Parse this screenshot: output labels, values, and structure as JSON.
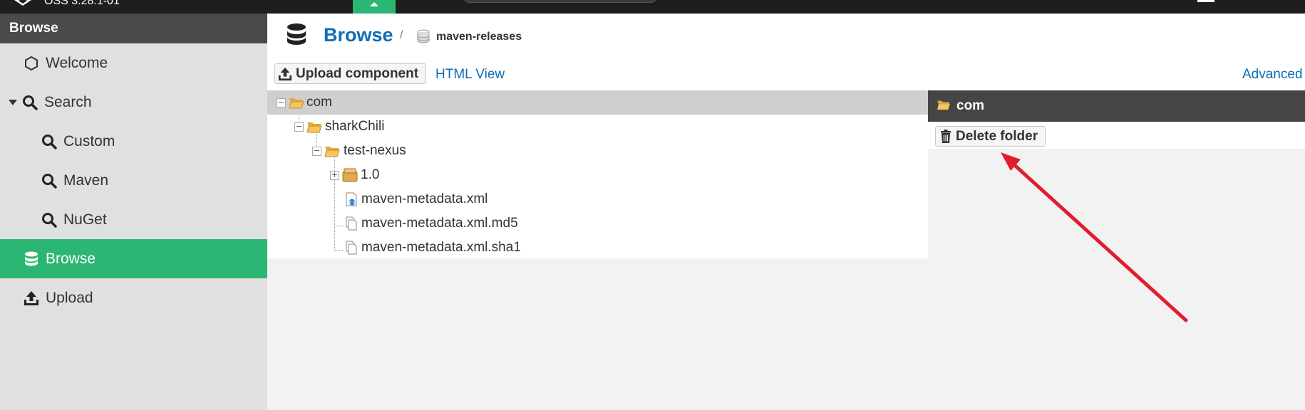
{
  "topbar": {
    "version": "OSS 3.28.1-01"
  },
  "sidebar": {
    "header": "Browse",
    "items": [
      {
        "label": "Welcome",
        "icon": "hexagon-icon"
      },
      {
        "label": "Search",
        "icon": "search-icon"
      },
      {
        "label": "Custom",
        "icon": "search-icon"
      },
      {
        "label": "Maven",
        "icon": "search-icon"
      },
      {
        "label": "NuGet",
        "icon": "search-icon"
      },
      {
        "label": "Browse",
        "icon": "database-icon",
        "active": true
      },
      {
        "label": "Upload",
        "icon": "upload-icon"
      }
    ]
  },
  "breadcrumb": {
    "title": "Browse",
    "separator": "/",
    "repository": "maven-releases"
  },
  "toolbar": {
    "upload_label": "Upload component",
    "html_view_label": "HTML View",
    "advanced_label": "Advanced"
  },
  "tree": [
    {
      "label": "com",
      "icon": "folder-open-icon",
      "depth": 0,
      "expander": "−",
      "selected": true
    },
    {
      "label": "sharkChili",
      "icon": "folder-open-icon",
      "depth": 1,
      "expander": "−"
    },
    {
      "label": "test-nexus",
      "icon": "folder-open-icon",
      "depth": 2,
      "expander": "−"
    },
    {
      "label": "1.0",
      "icon": "package-icon",
      "depth": 3,
      "expander": "+"
    },
    {
      "label": "maven-metadata.xml",
      "icon": "xml-file-icon",
      "depth": 3
    },
    {
      "label": "maven-metadata.xml.md5",
      "icon": "file-icon",
      "depth": 3
    },
    {
      "label": "maven-metadata.xml.sha1",
      "icon": "file-icon",
      "depth": 3
    }
  ],
  "detail": {
    "title": "com",
    "delete_label": "Delete folder"
  },
  "colors": {
    "accent": "#2bb673",
    "link": "#0d6db6",
    "annotation_arrow": "#e01e2b"
  }
}
